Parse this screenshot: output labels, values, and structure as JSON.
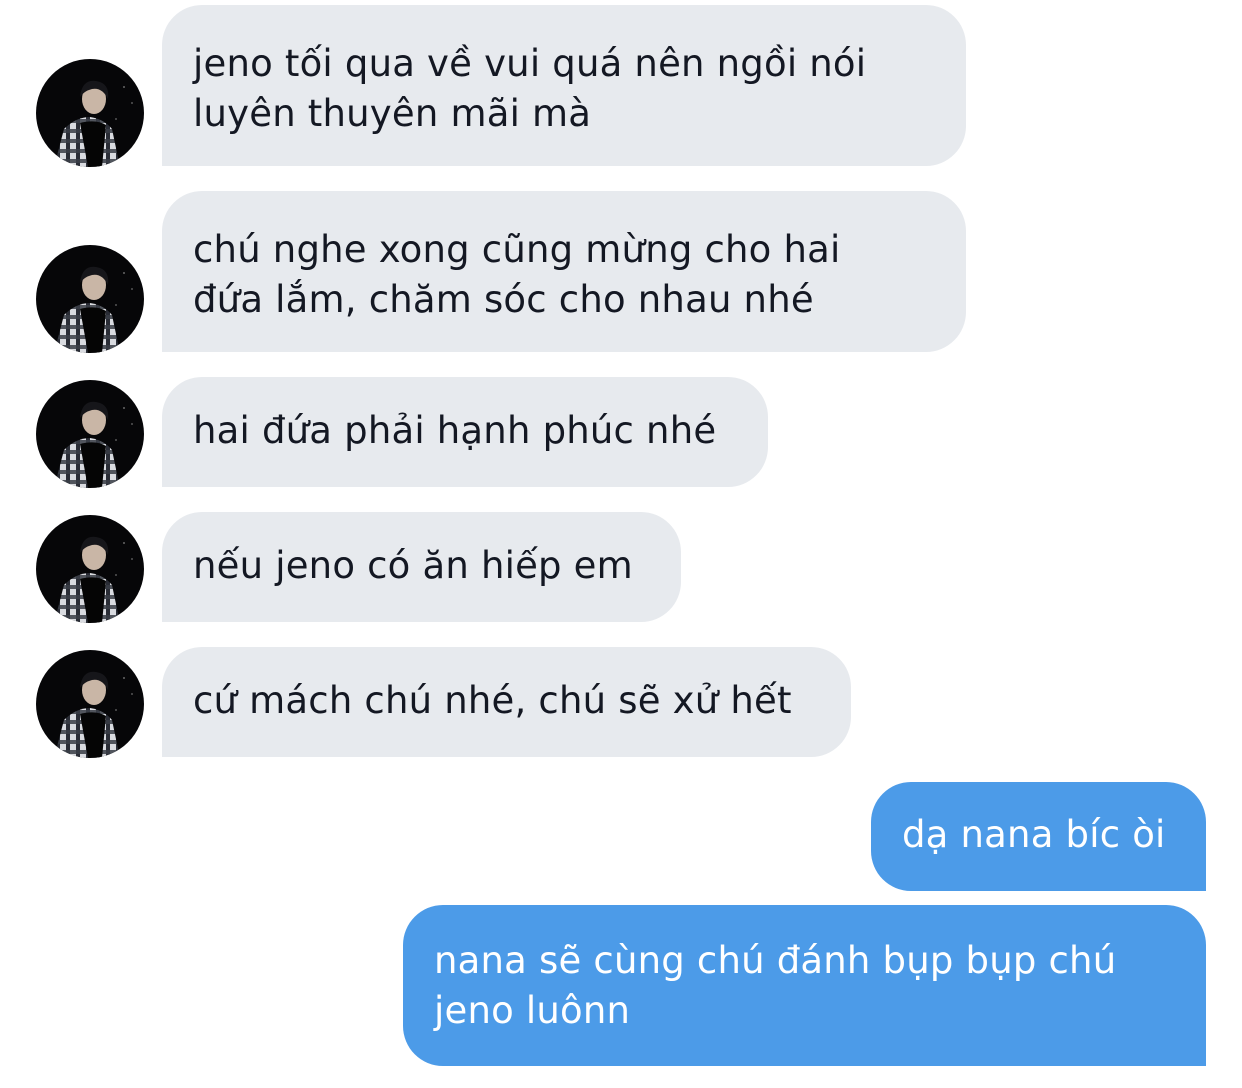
{
  "conversation": {
    "incoming": [
      {
        "line1": "jeno tối qua về vui quá nên ngồi nói",
        "line2": "luyên thuyên mãi mà"
      },
      {
        "line1": "chú nghe xong cũng mừng cho hai",
        "line2": "đứa lắm, chăm sóc cho nhau nhé"
      },
      {
        "line1": "hai đứa phải hạnh phúc nhé",
        "line2": ""
      },
      {
        "line1": "nếu jeno có ăn hiếp em",
        "line2": ""
      },
      {
        "line1": "cứ mách chú nhé, chú sẽ xử hết",
        "line2": ""
      }
    ],
    "outgoing": [
      {
        "line1": "dạ nana bíc òi",
        "line2": ""
      },
      {
        "line1": "nana sẽ cùng chú đánh bụp bụp chú",
        "line2": "jeno luônn"
      }
    ]
  },
  "colors": {
    "incoming_bubble": "#e7eaee",
    "outgoing_bubble": "#4c9be8",
    "incoming_text": "#141823",
    "outgoing_text": "#ffffff"
  },
  "icons": {
    "avatar": "contact-avatar-photo"
  }
}
